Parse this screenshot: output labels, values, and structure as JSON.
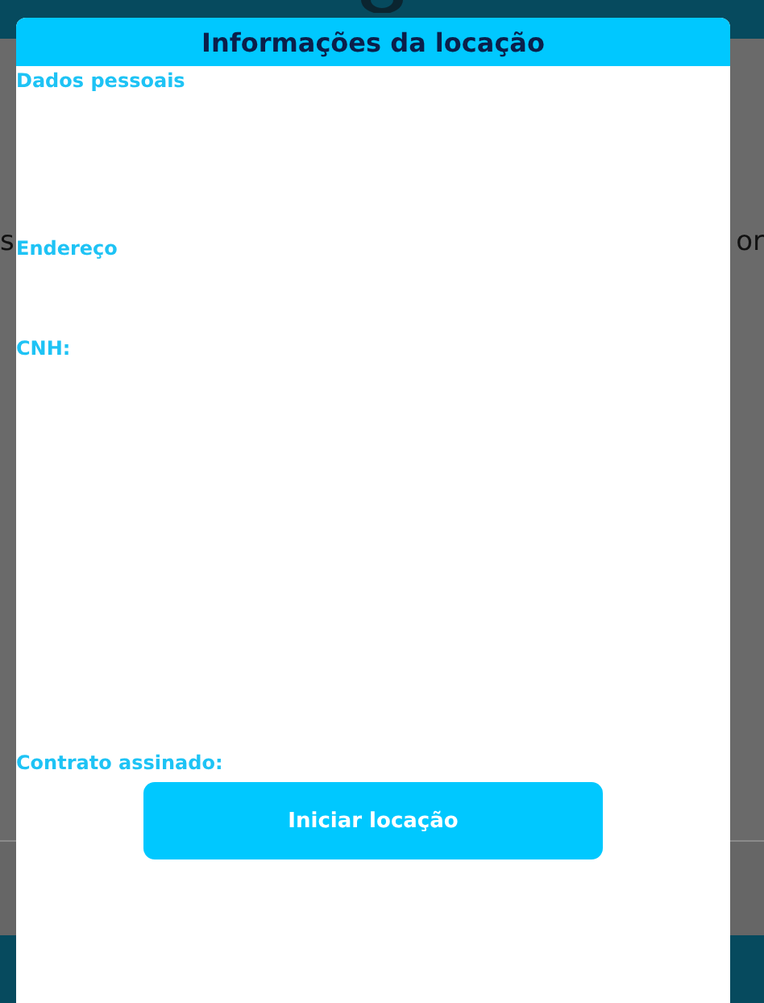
{
  "background": {
    "left_text": "s",
    "right_text": "or"
  },
  "modal": {
    "title": "Informações da locação",
    "sections": [
      {
        "label": "Dados pessoais"
      },
      {
        "label": "Endereço"
      },
      {
        "label": "CNH:"
      },
      {
        "label": "Contrato assinado:"
      }
    ],
    "button": "Iniciar locação"
  }
}
